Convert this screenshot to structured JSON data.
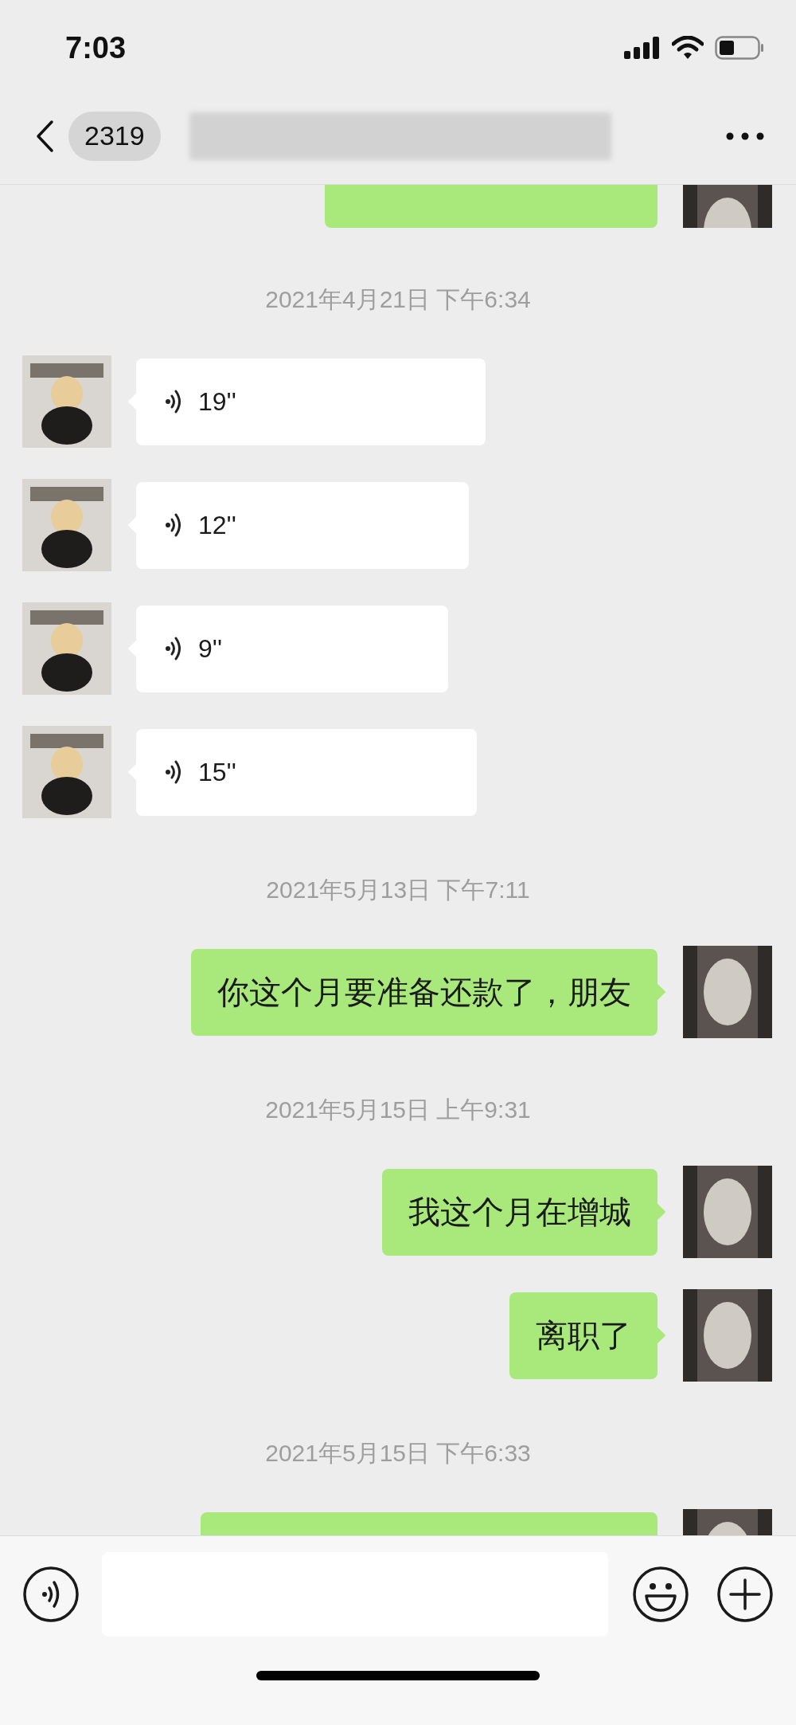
{
  "status_bar": {
    "time": "7:03"
  },
  "nav": {
    "back_badge": "2319"
  },
  "messages": [
    {
      "kind": "cut_top_out"
    },
    {
      "kind": "timestamp",
      "text": "2021年4月21日 下午6:34"
    },
    {
      "kind": "voice_in",
      "duration": "19''"
    },
    {
      "kind": "voice_in",
      "duration": "12''"
    },
    {
      "kind": "voice_in",
      "duration": "9''"
    },
    {
      "kind": "voice_in",
      "duration": "15''"
    },
    {
      "kind": "timestamp",
      "text": "2021年5月13日 下午7:11"
    },
    {
      "kind": "text_out",
      "text": "你这个月要准备还款了，朋友"
    },
    {
      "kind": "timestamp",
      "text": "2021年5月15日 上午9:31"
    },
    {
      "kind": "text_out",
      "text": "我这个月在增城"
    },
    {
      "kind": "text_out",
      "text": "离职了"
    },
    {
      "kind": "timestamp",
      "text": "2021年5月15日 下午6:33"
    },
    {
      "kind": "cut_bottom_out"
    }
  ]
}
